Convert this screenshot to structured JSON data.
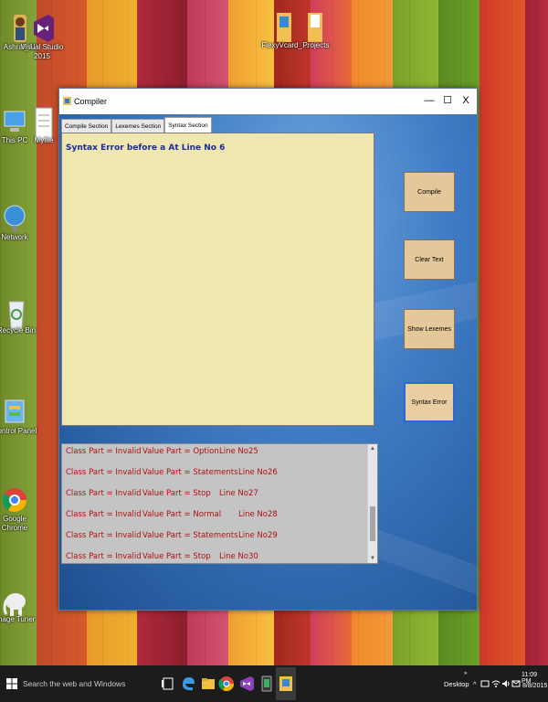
{
  "desktop": {
    "icons": [
      {
        "label": "Ashraf_Ali"
      },
      {
        "label": "Visual Studio 2015"
      },
      {
        "label": "FlexyVcard_..."
      },
      {
        "label": "Projects"
      },
      {
        "label": "This PC"
      },
      {
        "label": "Myfile"
      },
      {
        "label": "Network"
      },
      {
        "label": "Recycle Bin"
      },
      {
        "label": "Control Panel"
      },
      {
        "label": "Google Chrome"
      },
      {
        "label": "Image Tuner"
      }
    ]
  },
  "window": {
    "title": "Compiler",
    "controls": {
      "minimize": "—",
      "maximize": "☐",
      "close": "X"
    }
  },
  "tabs": [
    {
      "label": "Compile Section"
    },
    {
      "label": "Lexemes Section"
    },
    {
      "label": "Syntax Section"
    }
  ],
  "syntax_output": "Syntax Error before a At Line No 6",
  "buttons": {
    "compile": "Compile",
    "clear": "Clear Text",
    "show_lexemes": "Show Lexemes",
    "syntax_error": "Syntax Error"
  },
  "output_lines": [
    {
      "class_part": "Class Part = Invalid",
      "value_part": "Value Part = Option",
      "line": "Line No25"
    },
    {
      "class_part": "Class Part = Invalid",
      "value_part": "Value Part = Statements",
      "line": "Line No26"
    },
    {
      "class_part": "Class Part = Invalid",
      "value_part": "Value Part = Stop",
      "line": "Line No27"
    },
    {
      "class_part": "Class Part = Invalid",
      "value_part": "Value Part = Normal",
      "line": "Line No28"
    },
    {
      "class_part": "Class Part = Invalid",
      "value_part": "Value Part = Statements",
      "line": "Line No29"
    },
    {
      "class_part": "Class Part = Invalid",
      "value_part": "Value Part = Stop",
      "line": "Line No30"
    }
  ],
  "taskbar": {
    "search_placeholder": "Search the web and Windows",
    "desktop_label": "Desktop",
    "time": "11:09 PM",
    "date": "8/8/2015"
  }
}
